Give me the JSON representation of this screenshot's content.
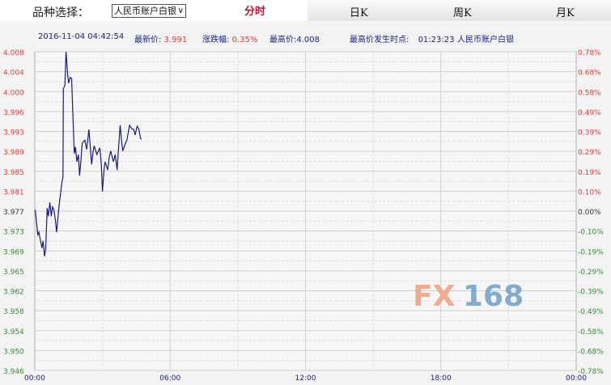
{
  "header": {
    "select_label": "品种选择：",
    "select_value": "人民币账户白银",
    "tabs": [
      "分时",
      "日K",
      "周K",
      "月K"
    ]
  },
  "info": {
    "datetime": "2016-11-04 04:42:54",
    "latest_label": "最新价:",
    "latest": "3.991",
    "change_label": "涨跌幅:",
    "change": "0.35%",
    "high_label": "最高价:",
    "high": "4.008",
    "high_time_label": "最高价发生时点:",
    "high_time": "01:23:23",
    "name": "人民币账户白银"
  },
  "watermark": "FX168",
  "colors": {
    "line": "#1a1a7a",
    "up": "#e53935",
    "down": "#3a8a3a",
    "base": "#333333"
  },
  "chart_data": {
    "type": "line",
    "base_price": 3.977,
    "ylim": [
      3.946,
      4.008
    ],
    "y_ticks": [
      "4.008",
      "4.004",
      "4.000",
      "3.996",
      "3.993",
      "3.989",
      "3.985",
      "3.981",
      "3.977",
      "3.973",
      "3.969",
      "3.965",
      "3.962",
      "3.958",
      "3.954",
      "3.950",
      "3.946"
    ],
    "y2_ticks": [
      "0.78%",
      "0.68%",
      "0.58%",
      "0.49%",
      "0.39%",
      "0.29%",
      "0.19%",
      "0.10%",
      "0.00%",
      "-0.10%",
      "-0.19%",
      "-0.29%",
      "-0.39%",
      "-0.49%",
      "-0.58%",
      "-0.68%",
      "-0.78%"
    ],
    "x_ticks": [
      "00:00",
      "06:00",
      "12:00",
      "18:00",
      "00:00"
    ],
    "xlim_minutes": [
      0,
      1440
    ],
    "series": [
      {
        "name": "人民币账户白银",
        "points": [
          [
            0,
            3.977
          ],
          [
            1,
            3.9772
          ],
          [
            8,
            3.9724
          ],
          [
            11,
            3.9729
          ],
          [
            19,
            3.9698
          ],
          [
            22,
            3.9712
          ],
          [
            26,
            3.9682
          ],
          [
            29,
            3.9698
          ],
          [
            33,
            3.9776
          ],
          [
            36,
            3.976
          ],
          [
            40,
            3.9787
          ],
          [
            44,
            3.976
          ],
          [
            47,
            3.9778
          ],
          [
            51,
            3.9772
          ],
          [
            55,
            3.975
          ],
          [
            58,
            3.9729
          ],
          [
            65,
            3.9783
          ],
          [
            69,
            3.9808
          ],
          [
            73,
            3.983
          ],
          [
            75,
            3.9835
          ],
          [
            76,
            4.0008
          ],
          [
            80,
            4.0015
          ],
          [
            83,
            4.008
          ],
          [
            87,
            4.004
          ],
          [
            90,
            4.0019
          ],
          [
            94,
            4.003
          ],
          [
            98,
            4.0028
          ],
          [
            101,
            3.9965
          ],
          [
            105,
            3.9882
          ],
          [
            108,
            3.9895
          ],
          [
            112,
            3.9866
          ],
          [
            116,
            3.988
          ],
          [
            119,
            3.9839
          ],
          [
            123,
            3.987
          ],
          [
            126,
            3.9902
          ],
          [
            133,
            3.9908
          ],
          [
            138,
            3.989
          ],
          [
            144,
            3.9929
          ],
          [
            151,
            3.9861
          ],
          [
            155,
            3.9885
          ],
          [
            158,
            3.9897
          ],
          [
            165,
            3.988
          ],
          [
            173,
            3.9893
          ],
          [
            177,
            3.986
          ],
          [
            180,
            3.9808
          ],
          [
            184,
            3.985
          ],
          [
            187,
            3.9866
          ],
          [
            194,
            3.985
          ],
          [
            198,
            3.9875
          ],
          [
            202,
            3.9887
          ],
          [
            209,
            3.9866
          ],
          [
            214,
            3.988
          ],
          [
            219,
            3.985
          ],
          [
            223,
            3.9895
          ],
          [
            227,
            3.9937
          ],
          [
            231,
            3.9905
          ],
          [
            234,
            3.9887
          ],
          [
            240,
            3.99
          ],
          [
            245,
            3.9908
          ],
          [
            252,
            3.9937
          ],
          [
            258,
            3.993
          ],
          [
            263,
            3.9929
          ],
          [
            267,
            3.9918
          ],
          [
            272,
            3.9935
          ],
          [
            277,
            3.9929
          ],
          [
            281,
            3.9912
          ],
          [
            284,
            3.991
          ]
        ]
      }
    ]
  }
}
